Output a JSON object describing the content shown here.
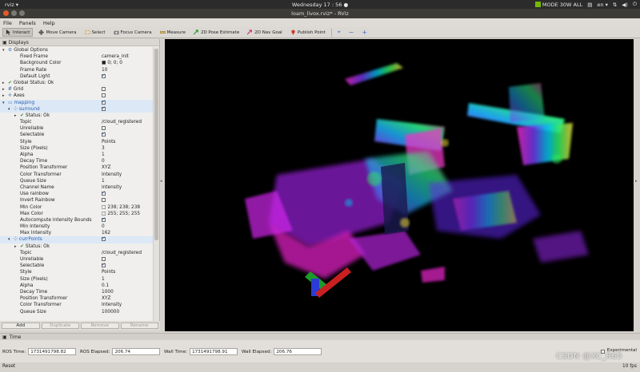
{
  "topbar": {
    "app_name": "rviz ▾",
    "clock": "Wednesday 17 : 56 ●",
    "nvidia_mode": "MODE 30W ALL",
    "lang": "en ▾"
  },
  "window": {
    "title": "loam_livox.rviz* - RViz"
  },
  "menu": [
    "File",
    "Panels",
    "Help"
  ],
  "toolbar": {
    "interact": "Interact",
    "move_camera": "Move Camera",
    "select": "Select",
    "focus_camera": "Focus Camera",
    "measure": "Measure",
    "pose_estimate": "2D Pose Estimate",
    "nav_goal": "2D Nav Goal",
    "publish_point": "Publish Point",
    "zoom_in": "+",
    "zoom_out": "−",
    "add_tool": "+"
  },
  "displays": {
    "header": "Displays",
    "rows": [
      {
        "label": "Global Options",
        "value": "",
        "indent": 0,
        "arrow": "▾",
        "icon": "gear-icon",
        "check": ""
      },
      {
        "label": "Fixed Frame",
        "value": "camera_init",
        "indent": 2,
        "arrow": "",
        "icon": "",
        "check": ""
      },
      {
        "label": "Background Color",
        "value": "■ 0; 0; 0",
        "indent": 2,
        "arrow": "",
        "icon": "",
        "check": ""
      },
      {
        "label": "Frame Rate",
        "value": "10",
        "indent": 2,
        "arrow": "",
        "icon": "",
        "check": ""
      },
      {
        "label": "Default Light",
        "value": "",
        "indent": 2,
        "arrow": "",
        "icon": "",
        "check": "on"
      },
      {
        "label": "Global Status: Ok",
        "value": "",
        "indent": 0,
        "arrow": "▸",
        "icon": "ok-icon",
        "check": ""
      },
      {
        "label": "Grid",
        "value": "",
        "indent": 0,
        "arrow": "▸",
        "icon": "grid-icon",
        "check": "off"
      },
      {
        "label": "Axes",
        "value": "",
        "indent": 0,
        "arrow": "▸",
        "icon": "axes-icon",
        "check": "off"
      },
      {
        "label": "mapping",
        "value": "",
        "indent": 0,
        "arrow": "▾",
        "icon": "folder-icon",
        "check": "on",
        "blue": true
      },
      {
        "label": "surround",
        "value": "",
        "indent": 1,
        "arrow": "▾",
        "icon": "pointcloud-icon",
        "check": "on",
        "blue": true
      },
      {
        "label": "Status: Ok",
        "value": "",
        "indent": 2,
        "arrow": "▸",
        "icon": "ok-icon",
        "check": ""
      },
      {
        "label": "Topic",
        "value": "/cloud_registered",
        "indent": 2,
        "arrow": "",
        "icon": "",
        "check": ""
      },
      {
        "label": "Unreliable",
        "value": "",
        "indent": 2,
        "arrow": "",
        "icon": "",
        "check": "off"
      },
      {
        "label": "Selectable",
        "value": "",
        "indent": 2,
        "arrow": "",
        "icon": "",
        "check": "on"
      },
      {
        "label": "Style",
        "value": "Points",
        "indent": 2,
        "arrow": "",
        "icon": "",
        "check": ""
      },
      {
        "label": "Size (Pixels)",
        "value": "3",
        "indent": 2,
        "arrow": "",
        "icon": "",
        "check": ""
      },
      {
        "label": "Alpha",
        "value": "1",
        "indent": 2,
        "arrow": "",
        "icon": "",
        "check": ""
      },
      {
        "label": "Decay Time",
        "value": "0",
        "indent": 2,
        "arrow": "",
        "icon": "",
        "check": ""
      },
      {
        "label": "Position Transformer",
        "value": "XYZ",
        "indent": 2,
        "arrow": "",
        "icon": "",
        "check": ""
      },
      {
        "label": "Color Transformer",
        "value": "Intensity",
        "indent": 2,
        "arrow": "",
        "icon": "",
        "check": ""
      },
      {
        "label": "Queue Size",
        "value": "1",
        "indent": 2,
        "arrow": "",
        "icon": "",
        "check": ""
      },
      {
        "label": "Channel Name",
        "value": "intensity",
        "indent": 2,
        "arrow": "",
        "icon": "",
        "check": ""
      },
      {
        "label": "Use rainbow",
        "value": "",
        "indent": 2,
        "arrow": "",
        "icon": "",
        "check": "on"
      },
      {
        "label": "Invert Rainbow",
        "value": "",
        "indent": 2,
        "arrow": "",
        "icon": "",
        "check": "off"
      },
      {
        "label": "Min Color",
        "value": "□ 238; 238; 238",
        "indent": 2,
        "arrow": "",
        "icon": "",
        "check": ""
      },
      {
        "label": "Max Color",
        "value": "□ 255; 255; 255",
        "indent": 2,
        "arrow": "",
        "icon": "",
        "check": ""
      },
      {
        "label": "Autocompute Intensity Bounds",
        "value": "",
        "indent": 2,
        "arrow": "",
        "icon": "",
        "check": "on"
      },
      {
        "label": "Min Intensity",
        "value": "0",
        "indent": 2,
        "arrow": "",
        "icon": "",
        "check": ""
      },
      {
        "label": "Max Intensity",
        "value": "162",
        "indent": 2,
        "arrow": "",
        "icon": "",
        "check": ""
      },
      {
        "label": "currPoints",
        "value": "",
        "indent": 1,
        "arrow": "▾",
        "icon": "pointcloud-icon",
        "check": "on",
        "blue": true
      },
      {
        "label": "Status: Ok",
        "value": "",
        "indent": 2,
        "arrow": "▸",
        "icon": "ok-icon",
        "check": ""
      },
      {
        "label": "Topic",
        "value": "/cloud_registered",
        "indent": 2,
        "arrow": "",
        "icon": "",
        "check": ""
      },
      {
        "label": "Unreliable",
        "value": "",
        "indent": 2,
        "arrow": "",
        "icon": "",
        "check": "off"
      },
      {
        "label": "Selectable",
        "value": "",
        "indent": 2,
        "arrow": "",
        "icon": "",
        "check": "on"
      },
      {
        "label": "Style",
        "value": "Points",
        "indent": 2,
        "arrow": "",
        "icon": "",
        "check": ""
      },
      {
        "label": "Size (Pixels)",
        "value": "1",
        "indent": 2,
        "arrow": "",
        "icon": "",
        "check": ""
      },
      {
        "label": "Alpha",
        "value": "0.1",
        "indent": 2,
        "arrow": "",
        "icon": "",
        "check": ""
      },
      {
        "label": "Decay Time",
        "value": "1000",
        "indent": 2,
        "arrow": "",
        "icon": "",
        "check": ""
      },
      {
        "label": "Position Transformer",
        "value": "XYZ",
        "indent": 2,
        "arrow": "",
        "icon": "",
        "check": ""
      },
      {
        "label": "Color Transformer",
        "value": "Intensity",
        "indent": 2,
        "arrow": "",
        "icon": "",
        "check": ""
      },
      {
        "label": "Queue Size",
        "value": "100000",
        "indent": 2,
        "arrow": "",
        "icon": "",
        "check": ""
      }
    ],
    "buttons": {
      "add": "Add",
      "duplicate": "Duplicate",
      "remove": "Remove",
      "rename": "Rename"
    }
  },
  "time_panel": {
    "header": "Time",
    "ros_time_label": "ROS Time:",
    "ros_time": "1731491798.82",
    "ros_elapsed_label": "ROS Elapsed:",
    "ros_elapsed": "206.74",
    "wall_time_label": "Wall Time:",
    "wall_time": "1731491798.91",
    "wall_elapsed_label": "Wall Elapsed:",
    "wall_elapsed": "206.76",
    "experimental": "Experimental"
  },
  "status": {
    "reset": "Reset",
    "fps": "10 fps"
  },
  "watermark": "CSDN @XC_R65"
}
